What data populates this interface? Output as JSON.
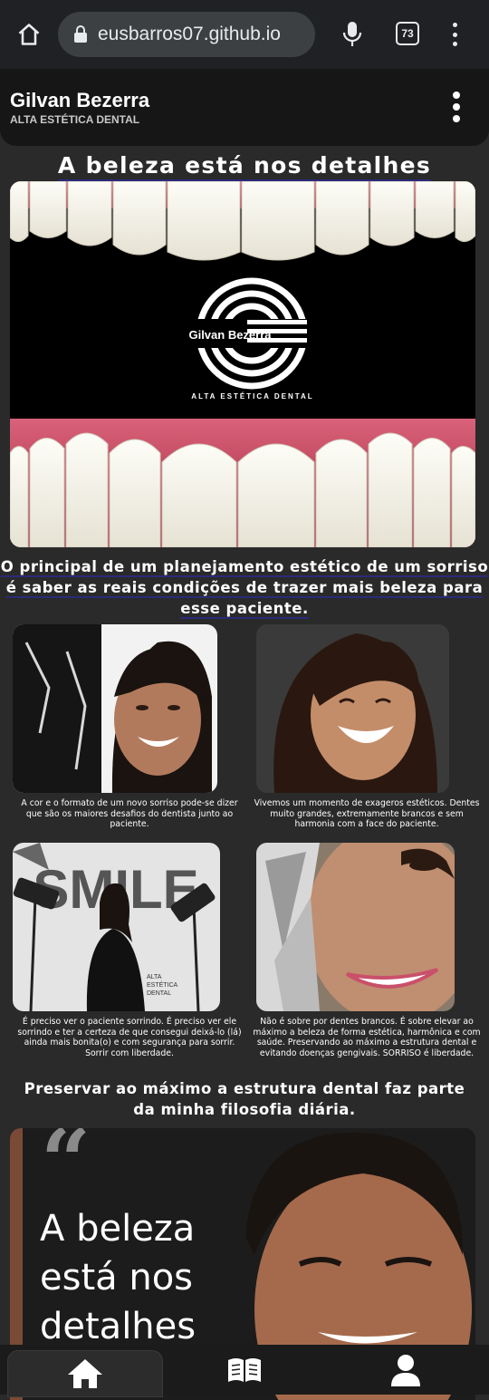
{
  "browser": {
    "url": "eusbarros07.github.io",
    "tab_count": "73"
  },
  "header": {
    "brand_name": "Gilvan Bezerra",
    "brand_subtitle": "ALTA ESTÉTICA DENTAL"
  },
  "hero": {
    "title": "A beleza está nos detalhes",
    "logo_name": "Gilvan Bezerra",
    "logo_tagline": "ALTA ESTÉTICA DENTAL"
  },
  "lead": "O principal de um planejamento estético de um sorriso é saber as reais condições de trazer mais beleza para esse paciente.",
  "cards": [
    {
      "caption": "A cor e o formato de um novo sorriso pode-se dizer que são os maiores desafios do dentista junto ao paciente."
    },
    {
      "caption": "Vivemos um momento de exageros estéticos. Dentes muito grandes, extremamente brancos e sem harmonia com a face do paciente."
    },
    {
      "caption": "É preciso ver o paciente sorrindo. É preciso ver ele sorrindo e ter a certeza de que consegui deixá-lo (lá) ainda mais bonita(o) e com segurança para sorrir. Sorrir com liberdade."
    },
    {
      "caption": "Não é sobre por dentes brancos. É sobre elevar ao máximo a beleza de forma estética, harmônica e com saúde. Preservando ao máximo a estrutura dental e evitando doenças gengivais. SORRISO é liberdade."
    }
  ],
  "card3_overlay": {
    "smile": "SMILE",
    "line1": "ALTA",
    "line2": "ESTÉTICA",
    "line3": "DENTAL"
  },
  "philosophy": "Preservar ao máximo a estrutura dental faz parte da minha filosofia diária.",
  "banner": {
    "quote_mark": "“",
    "line1": "A beleza",
    "line2": "está nos",
    "line3": "detalhes"
  },
  "nav": {
    "home_icon": "home-icon",
    "book_icon": "book-icon",
    "user_icon": "user-icon"
  }
}
